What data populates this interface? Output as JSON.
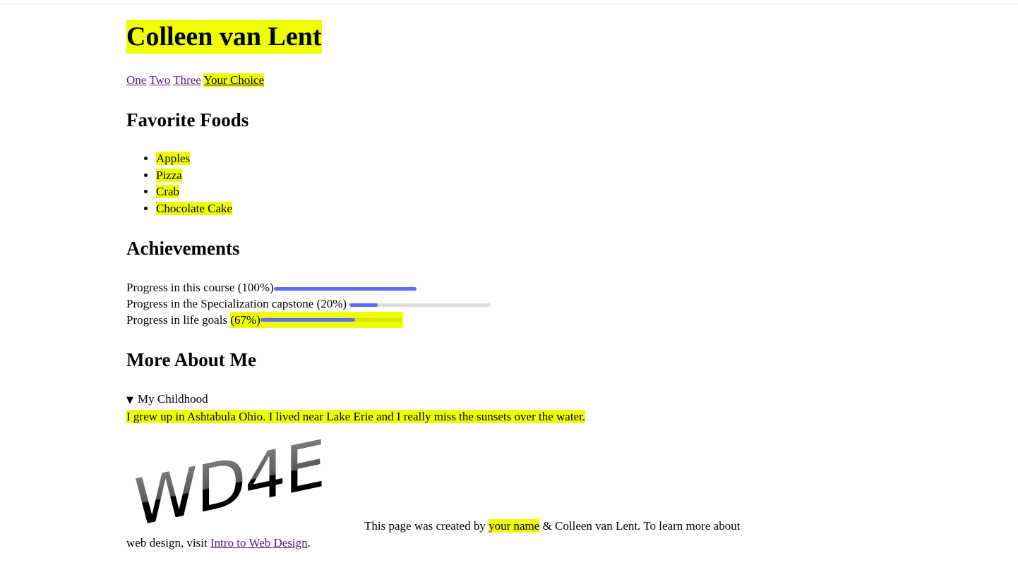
{
  "colors": {
    "highlight": "#eeff00",
    "progress_fill": "#5b6ef5",
    "progress_track": "#dedede",
    "link": "#551a8b"
  },
  "header": {
    "title": "Colleen van Lent"
  },
  "nav": {
    "items": [
      "One",
      "Two",
      "Three",
      "Your Choice"
    ]
  },
  "foods": {
    "heading": "Favorite Foods",
    "items": [
      "Apples",
      "Pizza",
      "Crab",
      "Chocolate Cake"
    ]
  },
  "achievements": {
    "heading": "Achievements",
    "items": [
      {
        "label": "Progress in this course (100%)",
        "value": 1.0
      },
      {
        "label": "Progress in the Specialization capstone (20%)",
        "value": 0.2
      },
      {
        "label_prefix": "Progress in life goals ",
        "label_hl": "(67%)",
        "value": 0.67
      }
    ]
  },
  "more": {
    "heading": "More About Me",
    "summary": "My Childhood",
    "text": "I grew up in Ashtabula Ohio. I lived near Lake Erie and I really miss the sunsets over the water."
  },
  "logo": {
    "text": "WD4E"
  },
  "footer": {
    "prefix": "This page was created by ",
    "name": "your name",
    "middle": " & Colleen van Lent. To learn more about",
    "line2_prefix": "web design, visit ",
    "link": "Intro to Web Design",
    "suffix": "."
  }
}
